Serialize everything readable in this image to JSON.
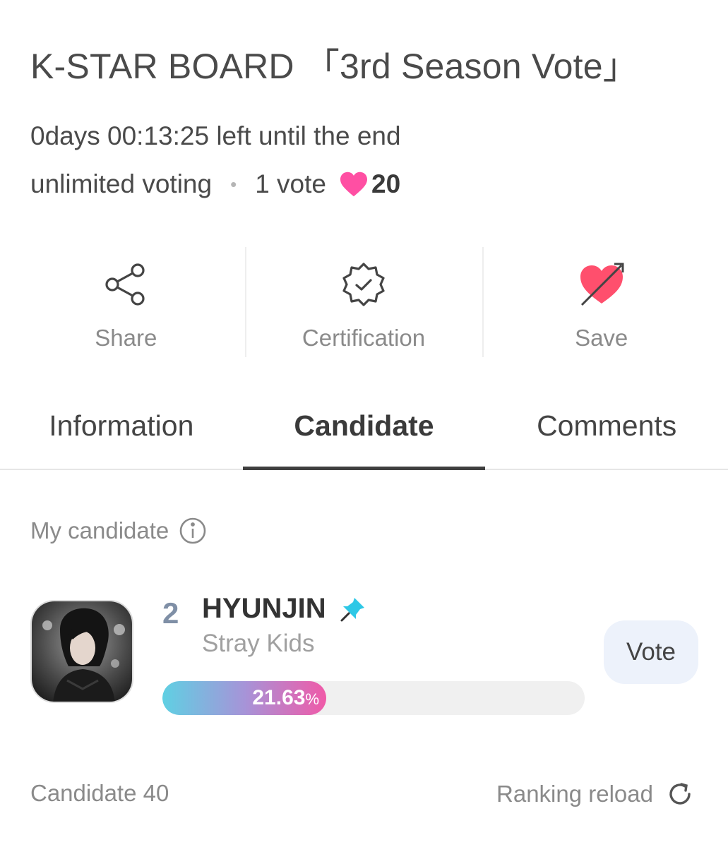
{
  "header": {
    "title": "K-STAR BOARD 「3rd Season Vote」",
    "deadline": "0days 00:13:25 left until the end",
    "voting_mode": "unlimited voting",
    "separator": "•",
    "per_vote": "1 vote",
    "heart_cost": "20",
    "heart_color": "#ff4fa3"
  },
  "actions": [
    {
      "label": "Share",
      "icon": "share-icon"
    },
    {
      "label": "Certification",
      "icon": "certification-badge-icon"
    },
    {
      "label": "Save",
      "icon": "heart-arrow-icon"
    }
  ],
  "tabs": [
    {
      "label": "Information",
      "active": false
    },
    {
      "label": "Candidate",
      "active": true
    },
    {
      "label": "Comments",
      "active": false
    }
  ],
  "my_candidate": {
    "section_label": "My candidate",
    "rank": "2",
    "name": "HYUNJIN",
    "group": "Stray Kids",
    "percent_value": "21.63",
    "percent_sign": "%",
    "percent_fraction": 0.2163,
    "vote_label": "Vote"
  },
  "footer": {
    "candidate_count": "Candidate 40",
    "reload_label": "Ranking reload"
  },
  "colors": {
    "accent_pink": "#ff4fa3",
    "pin_blue": "#2ec8e6",
    "vote_button_bg": "#edf2fb",
    "bar_gradient_start": "#5fd0e3",
    "bar_gradient_end": "#f05aa8"
  }
}
